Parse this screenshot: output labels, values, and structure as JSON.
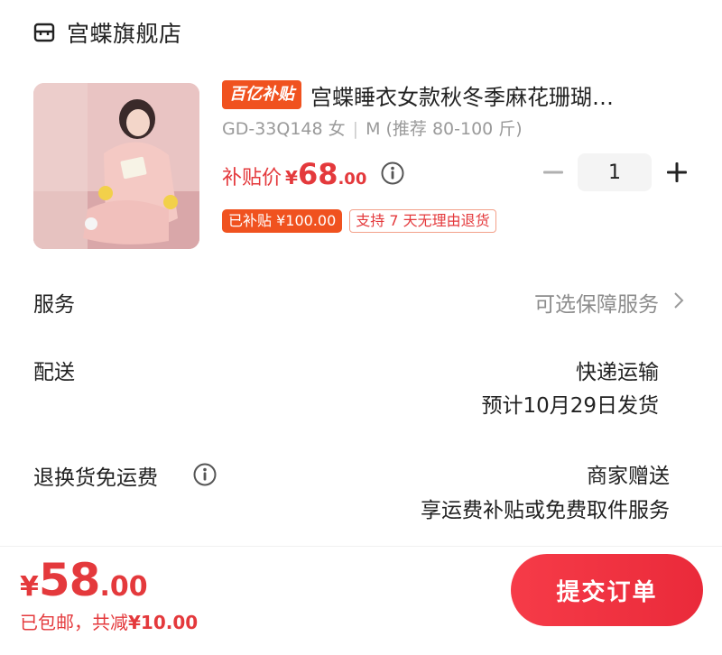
{
  "store": {
    "name": "宫蝶旗舰店",
    "icon": "store-icon"
  },
  "product": {
    "tag": "百亿补贴",
    "title": "宫蝶睡衣女款秋冬季麻花珊瑚…",
    "sku_code": "GD-33Q148 女",
    "sku_size": "M (推荐 80-100 斤)",
    "price_label": "补贴价",
    "price_currency": "¥",
    "price_int": "68",
    "price_dec": ".00",
    "badge_subsidized": "已补贴 ¥100.00",
    "badge_return": "支持 7 天无理由退货"
  },
  "quantity": {
    "value": "1"
  },
  "rows": {
    "service_label": "服务",
    "service_value": "可选保障服务",
    "delivery_label": "配送",
    "delivery_method": "快递运输",
    "delivery_eta": "预计10月29日发货",
    "return_label": "退换货免运费",
    "return_value": "商家赠送",
    "return_sub": "享运费补贴或免费取件服务"
  },
  "bottom": {
    "currency": "¥",
    "total_int": "58",
    "total_dec": ".00",
    "note_prefix": "已包邮，共减",
    "note_amount": "¥10.00",
    "submit_label": "提交订单"
  },
  "colors": {
    "accent_red": "#e4393c",
    "tag_orange": "#f0521f",
    "button_red": "#f23744"
  }
}
